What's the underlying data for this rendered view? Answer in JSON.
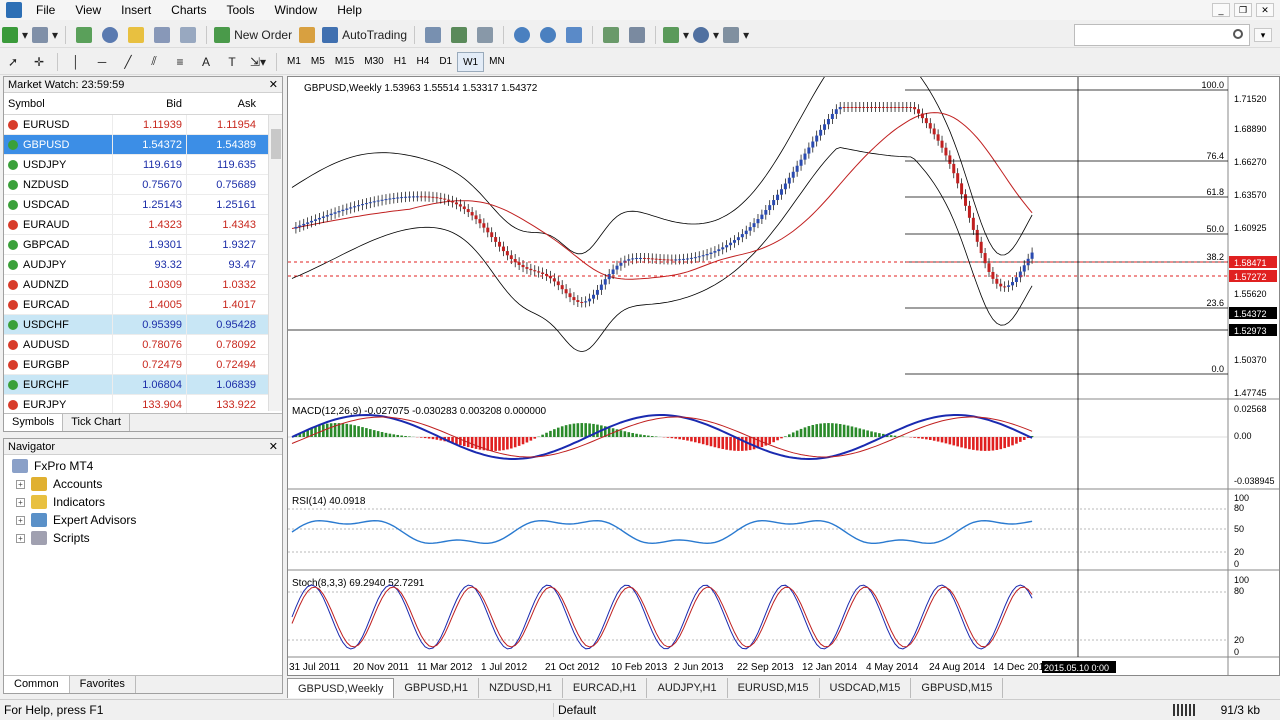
{
  "menu": [
    "File",
    "View",
    "Insert",
    "Charts",
    "Tools",
    "Window",
    "Help"
  ],
  "toolbar": {
    "new_order": "New Order",
    "auto_trading": "AutoTrading",
    "timeframes": [
      "M1",
      "M5",
      "M15",
      "M30",
      "H1",
      "H4",
      "D1",
      "W1",
      "MN"
    ],
    "active_timeframe": "W1"
  },
  "market_watch": {
    "title": "Market Watch: 23:59:59",
    "headers": {
      "symbol": "Symbol",
      "bid": "Bid",
      "ask": "Ask"
    },
    "rows": [
      {
        "symbol": "EURUSD",
        "bid": "1.11939",
        "ask": "1.11954",
        "dir": "down",
        "state": ""
      },
      {
        "symbol": "GBPUSD",
        "bid": "1.54372",
        "ask": "1.54389",
        "dir": "up",
        "state": "sel"
      },
      {
        "symbol": "USDJPY",
        "bid": "119.619",
        "ask": "119.635",
        "dir": "up",
        "state": ""
      },
      {
        "symbol": "NZDUSD",
        "bid": "0.75670",
        "ask": "0.75689",
        "dir": "up",
        "state": ""
      },
      {
        "symbol": "USDCAD",
        "bid": "1.25143",
        "ask": "1.25161",
        "dir": "up",
        "state": ""
      },
      {
        "symbol": "EURAUD",
        "bid": "1.4323",
        "ask": "1.4343",
        "dir": "down",
        "state": ""
      },
      {
        "symbol": "GBPCAD",
        "bid": "1.9301",
        "ask": "1.9327",
        "dir": "up",
        "state": ""
      },
      {
        "symbol": "AUDJPY",
        "bid": "93.32",
        "ask": "93.47",
        "dir": "up",
        "state": ""
      },
      {
        "symbol": "AUDNZD",
        "bid": "1.0309",
        "ask": "1.0332",
        "dir": "down",
        "state": ""
      },
      {
        "symbol": "EURCAD",
        "bid": "1.4005",
        "ask": "1.4017",
        "dir": "down",
        "state": ""
      },
      {
        "symbol": "USDCHF",
        "bid": "0.95399",
        "ask": "0.95428",
        "dir": "up",
        "state": "hl"
      },
      {
        "symbol": "AUDUSD",
        "bid": "0.78076",
        "ask": "0.78092",
        "dir": "down",
        "state": ""
      },
      {
        "symbol": "EURGBP",
        "bid": "0.72479",
        "ask": "0.72494",
        "dir": "down",
        "state": ""
      },
      {
        "symbol": "EURCHF",
        "bid": "1.06804",
        "ask": "1.06839",
        "dir": "up",
        "state": "hl"
      },
      {
        "symbol": "EURJPY",
        "bid": "133.904",
        "ask": "133.922",
        "dir": "down",
        "state": ""
      }
    ],
    "tabs": [
      "Symbols",
      "Tick Chart"
    ]
  },
  "navigator": {
    "title": "Navigator",
    "root": "FxPro MT4",
    "items": [
      "Accounts",
      "Indicators",
      "Expert Advisors",
      "Scripts"
    ],
    "tabs": [
      "Common",
      "Favorites"
    ]
  },
  "chart": {
    "header": "GBPUSD,Weekly  1.53963 1.55514 1.53317 1.54372",
    "macd_label": "MACD(12,26,9) -0.027075 -0.030283 0.003208 0.000000",
    "rsi_label": "RSI(14) 40.0918",
    "stoch_label": "Stoch(8,3,3) 69.2940 52.7291",
    "price_scale": [
      "1.71520",
      "1.68890",
      "1.66270",
      "1.63570",
      "1.60925",
      "1.55620",
      "1.50370",
      "1.47745"
    ],
    "price_tags": [
      {
        "text": "1.58471",
        "color": "#e02020"
      },
      {
        "text": "1.57272",
        "color": "#e02020"
      },
      {
        "text": "1.54372",
        "color": "#000000"
      },
      {
        "text": "1.52973",
        "color": "#000000"
      }
    ],
    "fib_levels": [
      "100.0",
      "76.4",
      "61.8",
      "50.0",
      "38.2",
      "23.6",
      "0.0"
    ],
    "macd_scale": [
      "0.02568",
      "0.00",
      "-0.038945"
    ],
    "rsi_scale": [
      "100",
      "80",
      "50",
      "20",
      "0"
    ],
    "stoch_scale": [
      "100",
      "80",
      "20",
      "0"
    ],
    "dates": [
      "31 Jul 2011",
      "20 Nov 2011",
      "11 Mar 2012",
      "1 Jul 2012",
      "21 Oct 2012",
      "10 Feb 2013",
      "2 Jun 2013",
      "22 Sep 2013",
      "12 Jan 2014",
      "4 May 2014",
      "24 Aug 2014",
      "14 Dec 201"
    ],
    "crosshair_date": "2015.05.10 0:00"
  },
  "chart_tabs": [
    "GBPUSD,Weekly",
    "GBPUSD,H1",
    "NZDUSD,H1",
    "EURCAD,H1",
    "AUDJPY,H1",
    "EURUSD,M15",
    "USDCAD,M15",
    "GBPUSD,M15"
  ],
  "status": {
    "help": "For Help, press F1",
    "profile": "Default",
    "traffic": "91/3 kb"
  }
}
